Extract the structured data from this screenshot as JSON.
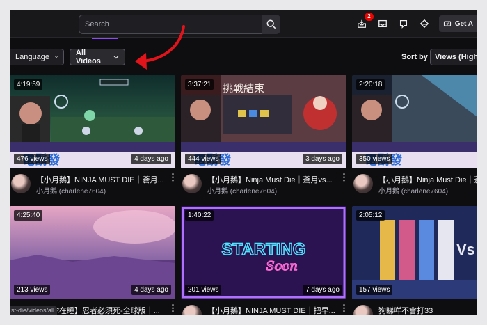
{
  "search": {
    "placeholder": "Search"
  },
  "header": {
    "notification_count": "2",
    "get_label": "Get A"
  },
  "filters": {
    "language_label": "Language",
    "all_videos_label": "All Videos",
    "sort_label": "Sort by",
    "sort_value": "Views (High"
  },
  "videos": [
    {
      "duration": "4:19:59",
      "views": "476 views",
      "ago": "4 days ago",
      "title": "【小月鵝】NINJA MUST DIE｜蒼月...",
      "channel": "小月鵝 (charlene7604)"
    },
    {
      "duration": "3:37:21",
      "views": "444 views",
      "ago": "3 days ago",
      "title": "【小月鵝】Ninja Must Die｜蒼月vs...",
      "channel": "小月鵝 (charlene7604)"
    },
    {
      "duration": "2:20:18",
      "views": "350 views",
      "ago": "",
      "title": "【小月鵝】Ninja Must Die｜蒼月...",
      "channel": "小月鵝 (charlene7604)"
    },
    {
      "duration": "4:25:40",
      "views": "213 views",
      "ago": "4 days ago",
      "title": "【當你在睡】忍者必須死-全球版｜...",
      "channel": ""
    },
    {
      "duration": "1:40:22",
      "views": "201 views",
      "ago": "7 days ago",
      "title": "【小月鵝】NINJA MUST DIE｜把早...",
      "channel": ""
    },
    {
      "duration": "2:05:12",
      "views": "157 views",
      "ago": "",
      "title": "狗睇咩不會打33",
      "channel": ""
    }
  ],
  "thumb_text": {
    "starting": "STARTING",
    "soon": "Soon",
    "challenge": "挑戰結束"
  },
  "status_url": "st-die/videos/all",
  "colors": {
    "accent": "#9147ff",
    "annotation_arrow": "#e0141a",
    "badge": "#eb0400"
  }
}
